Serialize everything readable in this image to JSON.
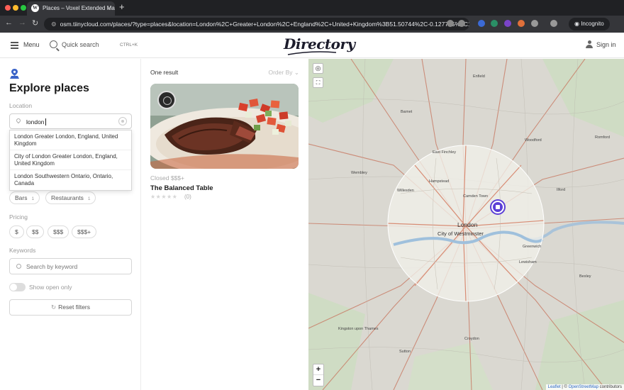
{
  "browser": {
    "tab_title": "Places – Voxel Extended Ma",
    "tab_close": "×",
    "new_tab": "+",
    "url": "osm.tiinycloud.com/places/?type=places&location=London%2C+Greater+London%2C+England%2C+United+Kingdom%3B51.50744%2C-0.127765%2C10",
    "incognito_label": "Incognito"
  },
  "header": {
    "menu_label": "Menu",
    "search_label": "Quick search",
    "shortcut": "CTRL+K",
    "logo": "Directory",
    "signin_label": "Sign in"
  },
  "filters": {
    "title": "Explore places",
    "location_label": "Location",
    "location_value": "london",
    "suggestions": [
      "London Greater London, England, United Kingdom",
      "City of London Greater London, England, United Kingdom",
      "London Southwestern Ontario, Ontario, Canada"
    ],
    "categories": [
      {
        "label": "Bars",
        "count": "1"
      },
      {
        "label": "Restaurants",
        "count": "1"
      }
    ],
    "pricing_label": "Pricing",
    "pricing_options": [
      "$",
      "$$",
      "$$$",
      "$$$+"
    ],
    "keywords_label": "Keywords",
    "keyword_placeholder": "Search by keyword",
    "open_only_label": "Show open only",
    "reset_label": "Reset filters"
  },
  "results": {
    "count_label": "One result",
    "order_label": "Order By",
    "card": {
      "status": "Closed $$$+",
      "name": "The Balanced Table",
      "stars": "★★★★★",
      "rating_count": "(0)"
    }
  },
  "map": {
    "labels": [
      "London",
      "City of Westminster",
      "Hampstead",
      "Camden Town",
      "Willesden",
      "East Finchley",
      "Greenwich",
      "Lewisham",
      "Kingston upon Thames",
      "Croydon",
      "Enfield",
      "Barnet",
      "Woodford",
      "Ilford",
      "Bexley",
      "Sutton",
      "Wembley",
      "Romford"
    ],
    "zoom_in": "+",
    "zoom_out": "−",
    "attribution_leaflet": "Leaflet",
    "attribution_osm": "OpenStreetMap",
    "attribution_rest": "contributors"
  },
  "colors": {
    "accent": "#5b3fd6",
    "map_base": "#d8d6cf",
    "road": "#c87a64"
  }
}
